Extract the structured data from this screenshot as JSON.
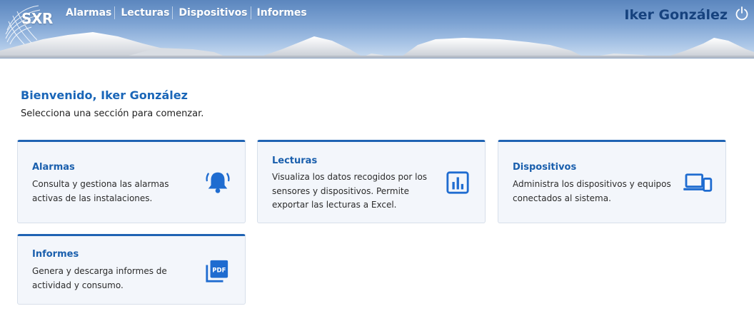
{
  "app": {
    "logo_text": "SXR"
  },
  "nav": {
    "items": [
      {
        "label": "Alarmas"
      },
      {
        "label": "Lecturas"
      },
      {
        "label": "Dispositivos"
      },
      {
        "label": "Informes"
      }
    ]
  },
  "user": {
    "name": "Iker González"
  },
  "welcome": {
    "title": "Bienvenido, Iker González",
    "subtitle": "Selecciona una sección para comenzar."
  },
  "cards": [
    {
      "title": "Alarmas",
      "description": "Consulta y gestiona las alarmas activas de las instalaciones.",
      "icon": "bell-icon"
    },
    {
      "title": "Lecturas",
      "description": "Visualiza los datos recogidos por los sensores y dispositivos. Permite exportar las lecturas a Excel.",
      "icon": "bar-chart-icon"
    },
    {
      "title": "Dispositivos",
      "description": "Administra los dispositivos y equipos conectados al sistema.",
      "icon": "devices-icon"
    },
    {
      "title": "Informes",
      "description": "Genera y descarga informes de actividad y consumo.",
      "icon": "pdf-icon"
    }
  ],
  "colors": {
    "accent": "#1f63b3",
    "card_bg": "#f3f6fb",
    "title_blue": "#1a66b8"
  }
}
